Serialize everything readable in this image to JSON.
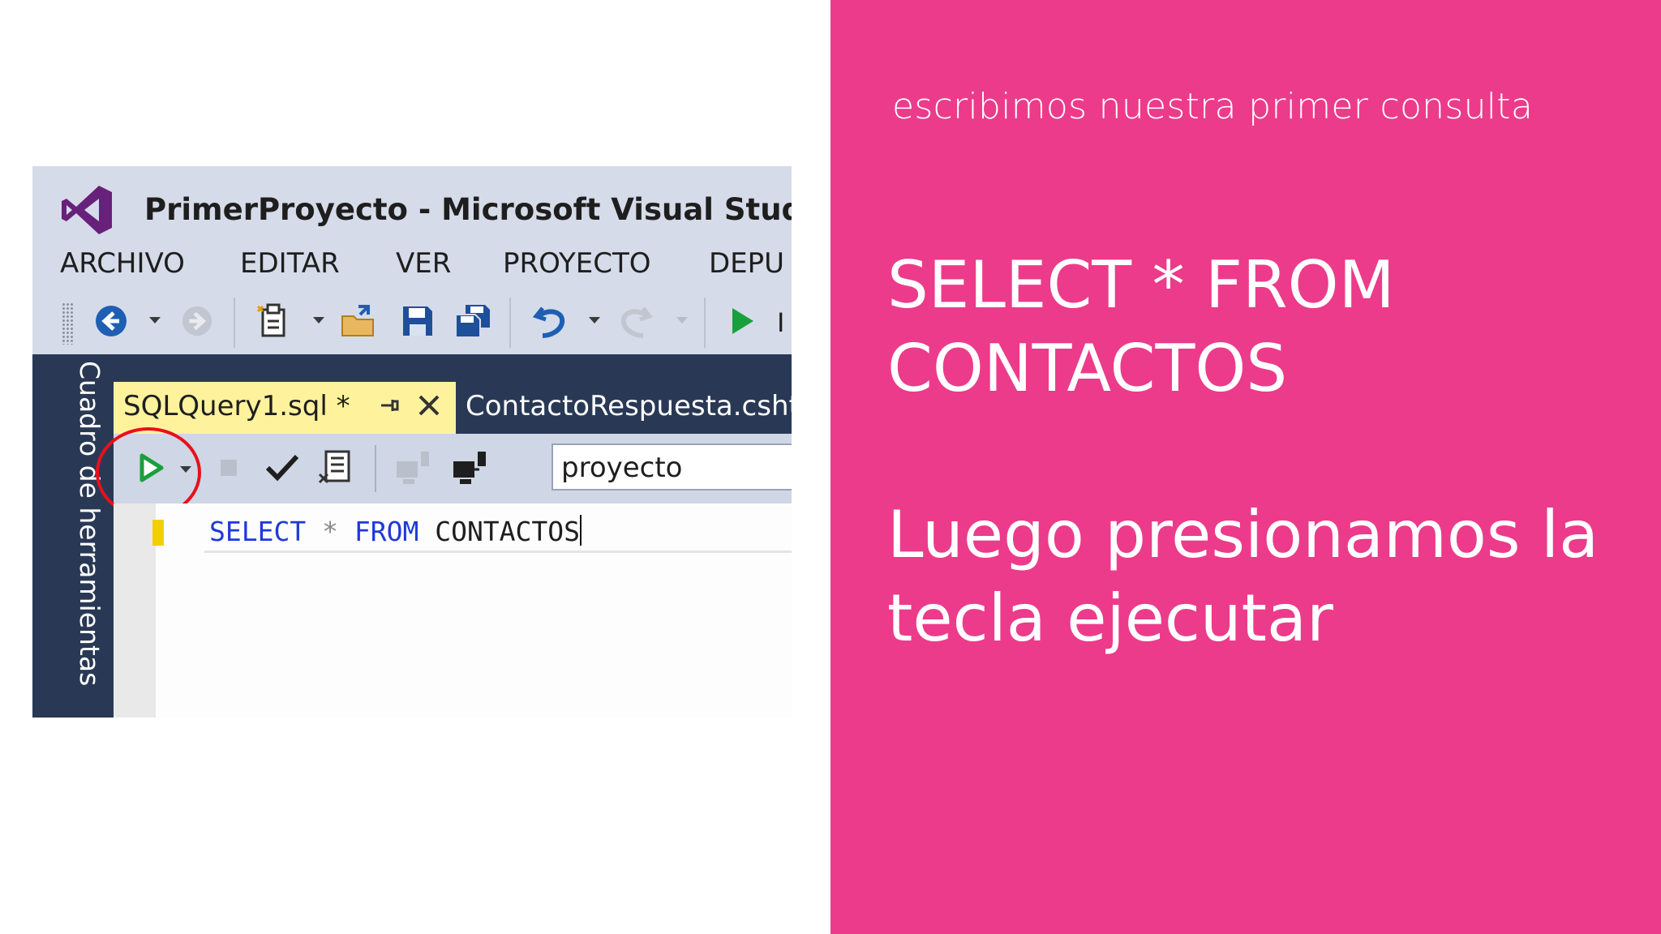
{
  "slide": {
    "instruction_small": "escribimos nuestra primer consulta",
    "query_caption_line1": "SELECT * FROM",
    "query_caption_line2": "CONTACTOS",
    "action_caption_line1": "Luego presionamos la",
    "action_caption_line2": "tecla ejecutar",
    "accent_color": "#ec3b8a"
  },
  "vs": {
    "app_title": "PrimerProyecto - Microsoft Visual Studio I",
    "menu": [
      "ARCHIVO",
      "EDITAR",
      "VER",
      "PROYECTO",
      "DEPU"
    ],
    "toolbar_trailing_text": "I",
    "side_panel_label": "Cuadro de herramientas",
    "tabs": {
      "active": "SQLQuery1.sql *",
      "inactive": "ContactoRespuesta.csht"
    },
    "database_selector_value": "proyecto",
    "editor": {
      "kw_select": "SELECT",
      "star": "*",
      "kw_from": "FROM",
      "table": "CONTACTOS"
    },
    "icons": {
      "logo": "visual-studio-logo-icon",
      "execute": "execute-play-icon",
      "highlight_color": "#e8101b"
    }
  }
}
